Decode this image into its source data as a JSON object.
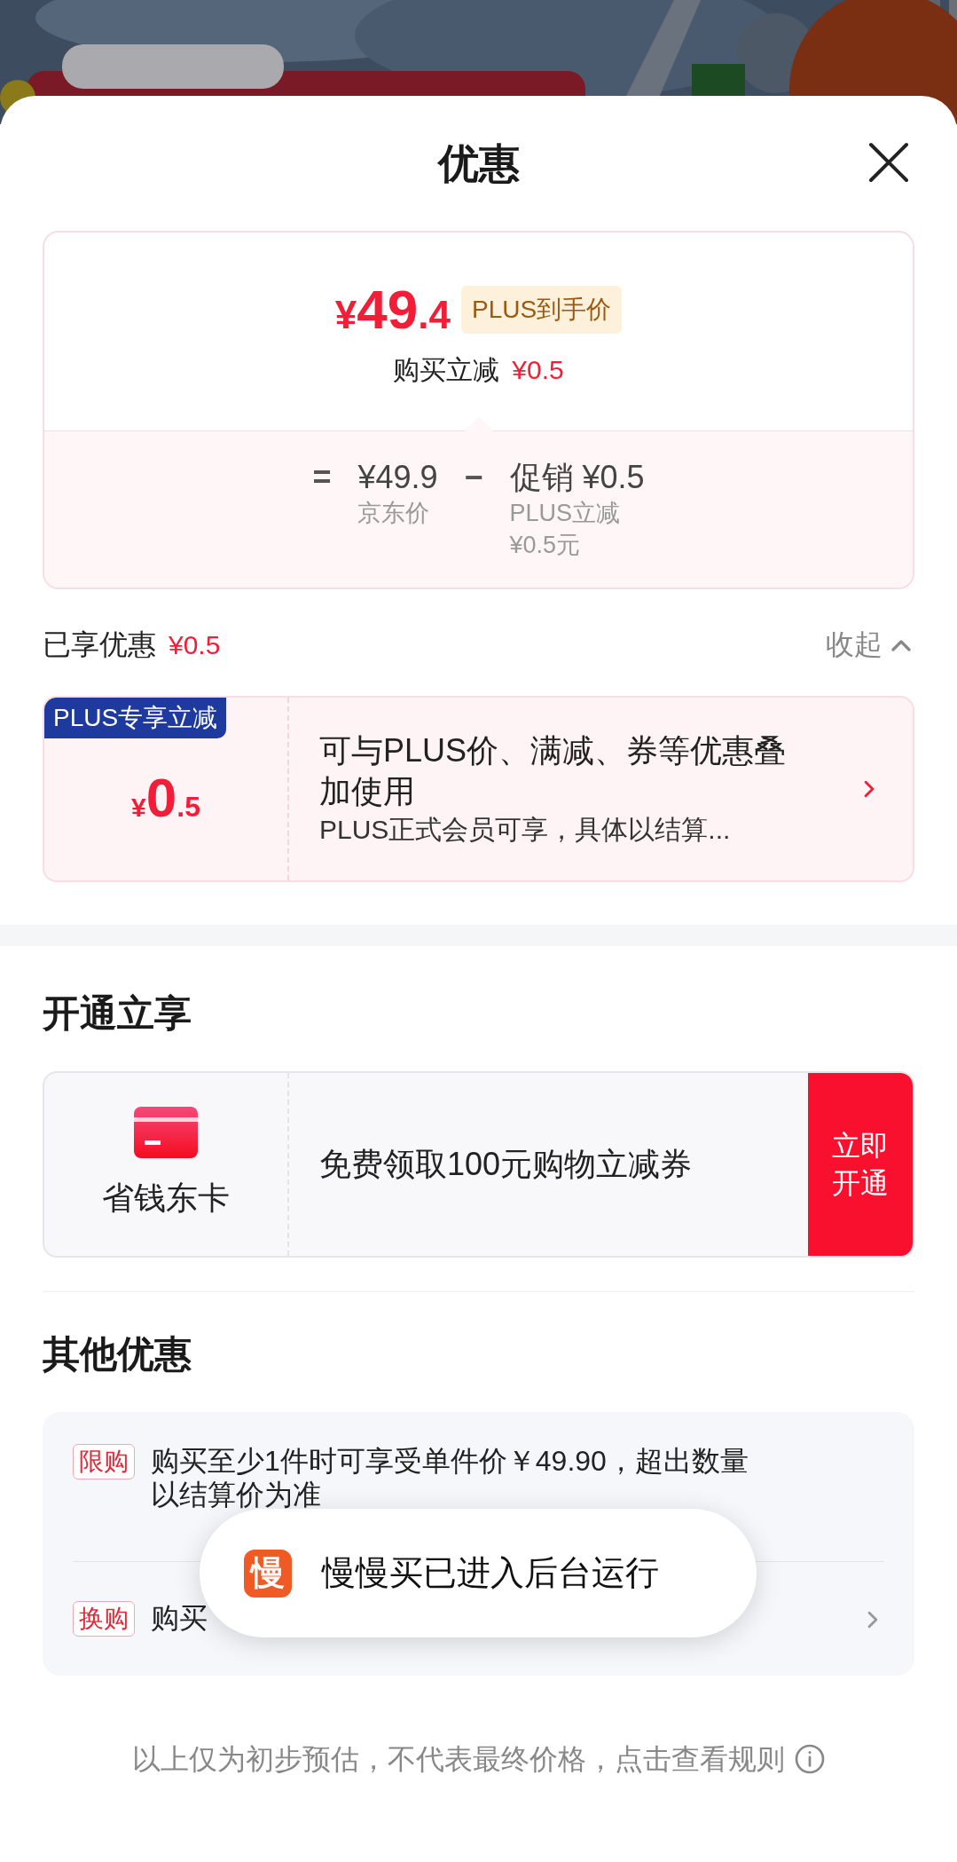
{
  "sheet": {
    "title": "优惠"
  },
  "price_card": {
    "currency": "¥",
    "integer": "49",
    "decimal": ".4",
    "badge": "PLUS到手价",
    "saving_label": "购买立减",
    "saving_value": "¥0.5",
    "breakdown": [
      {
        "kind": "operator",
        "text": "="
      },
      {
        "kind": "term",
        "value": "¥49.9",
        "notes": [
          "京东价"
        ]
      },
      {
        "kind": "operator",
        "text": "−"
      },
      {
        "kind": "term",
        "value": "促销 ¥0.5",
        "notes": [
          "PLUS立减",
          "¥0.5元"
        ]
      }
    ]
  },
  "enjoyed": {
    "label": "已享优惠",
    "value": "¥0.5",
    "toggle": {
      "label": "收起",
      "expanded": true
    }
  },
  "coupons": [
    {
      "tag": "PLUS专享立减",
      "currency": "¥",
      "integer": "0",
      "decimal": ".5",
      "title": "可与PLUS价、满减、券等优惠叠加使用",
      "note": "PLUS正式会员可享，具体以结算..."
    }
  ],
  "open_section": {
    "heading": "开通立享",
    "card_name": "省钱东卡",
    "offer": "免费领取100元购物立减券",
    "button": "立即开通"
  },
  "other_section": {
    "heading": "其他优惠",
    "rows": [
      {
        "tag": "限购",
        "text": "购买至少1件时可享受单件价￥49.90，超出数量以结算价为准",
        "arrow": false
      },
      {
        "tag": "换购",
        "text": "购买",
        "arrow": true
      }
    ]
  },
  "footer": "以上仅为初步预估，不代表最终价格，点击查看规则",
  "toast": {
    "app_icon": "慢",
    "message": "慢慢买已进入后台运行"
  }
}
